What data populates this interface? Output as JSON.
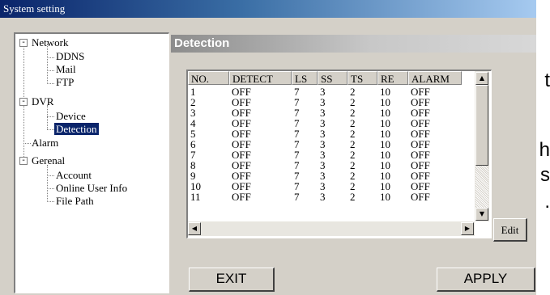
{
  "window": {
    "title": "System setting"
  },
  "background_fragments": [
    "t",
    "h",
    "s",
    "."
  ],
  "tree": {
    "items": [
      {
        "label": "Network"
      },
      {
        "label": "DDNS"
      },
      {
        "label": "Mail"
      },
      {
        "label": "FTP"
      },
      {
        "label": "DVR"
      },
      {
        "label": "Device"
      },
      {
        "label": "Detection"
      },
      {
        "label": "Alarm"
      },
      {
        "label": "Gerenal"
      },
      {
        "label": "Account"
      },
      {
        "label": "Online User Info"
      },
      {
        "label": "File Path"
      }
    ],
    "expander_symbol": "-"
  },
  "panel": {
    "title": "Detection"
  },
  "table": {
    "columns": [
      "NO.",
      "DETECT",
      "LS",
      "SS",
      "TS",
      "RE",
      "ALARM"
    ],
    "rows": [
      [
        "1",
        "OFF",
        "7",
        "3",
        "2",
        "10",
        "OFF"
      ],
      [
        "2",
        "OFF",
        "7",
        "3",
        "2",
        "10",
        "OFF"
      ],
      [
        "3",
        "OFF",
        "7",
        "3",
        "2",
        "10",
        "OFF"
      ],
      [
        "4",
        "OFF",
        "7",
        "3",
        "2",
        "10",
        "OFF"
      ],
      [
        "5",
        "OFF",
        "7",
        "3",
        "2",
        "10",
        "OFF"
      ],
      [
        "6",
        "OFF",
        "7",
        "3",
        "2",
        "10",
        "OFF"
      ],
      [
        "7",
        "OFF",
        "7",
        "3",
        "2",
        "10",
        "OFF"
      ],
      [
        "8",
        "OFF",
        "7",
        "3",
        "2",
        "10",
        "OFF"
      ],
      [
        "9",
        "OFF",
        "7",
        "3",
        "2",
        "10",
        "OFF"
      ],
      [
        "10",
        "OFF",
        "7",
        "3",
        "2",
        "10",
        "OFF"
      ],
      [
        "11",
        "OFF",
        "7",
        "3",
        "2",
        "10",
        "OFF"
      ]
    ]
  },
  "buttons": {
    "edit": "Edit",
    "exit": "EXIT",
    "apply": "APPLY"
  },
  "icons": {
    "scroll_up": "▲",
    "scroll_down": "▼",
    "scroll_left": "◀",
    "scroll_right": "▶"
  },
  "colors": {
    "titlebar": "#0a246a",
    "selection": "#0a246a",
    "dialog": "#d4d0c8"
  }
}
